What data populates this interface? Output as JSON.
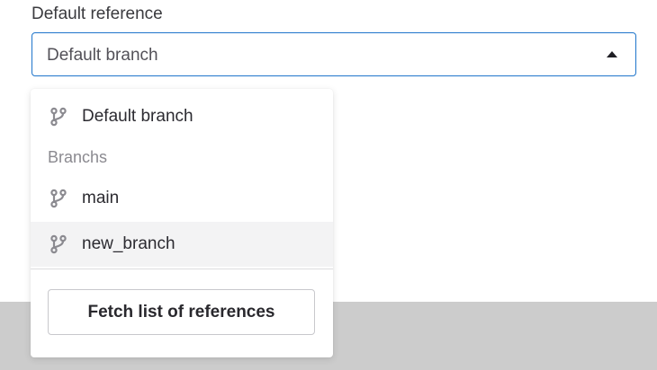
{
  "field": {
    "label": "Default reference",
    "selected_value": "Default branch"
  },
  "dropdown": {
    "items": [
      {
        "label": "Default branch",
        "icon": "branch-icon"
      },
      {
        "label": "main",
        "icon": "branch-icon"
      },
      {
        "label": "new_branch",
        "icon": "branch-icon",
        "highlighted": true
      }
    ],
    "group_header": "Branchs",
    "fetch_button_label": "Fetch list of references"
  },
  "colors": {
    "focus_border": "#1f75cb",
    "hover_bg": "#f3f3f4",
    "icon": "#8b8a90",
    "footer_band": "#cccccc"
  }
}
